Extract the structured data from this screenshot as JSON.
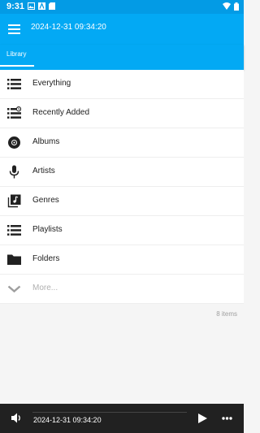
{
  "status_bar": {
    "time": "9:31",
    "left_icons": [
      "image-icon",
      "font-icon",
      "sd-card-icon"
    ],
    "right_icons": [
      "wifi-icon",
      "battery-icon"
    ]
  },
  "app_bar": {
    "title": "2024-12-31 09:34:20",
    "menu_icon": "hamburger-menu-icon"
  },
  "tabs": [
    {
      "label": "Library",
      "selected": true
    }
  ],
  "library": {
    "items": [
      {
        "label": "Everything",
        "icon": "list-icon"
      },
      {
        "label": "Recently Added",
        "icon": "recent-list-icon"
      },
      {
        "label": "Albums",
        "icon": "album-icon"
      },
      {
        "label": "Artists",
        "icon": "microphone-icon"
      },
      {
        "label": "Genres",
        "icon": "genre-icon"
      },
      {
        "label": "Playlists",
        "icon": "playlist-icon"
      },
      {
        "label": "Folders",
        "icon": "folder-icon"
      }
    ],
    "more": {
      "label": "More...",
      "icon": "chevron-down-icon"
    },
    "count": "8 items"
  },
  "player": {
    "title": "2024-12-31 09:34:20",
    "progress": 0,
    "volume_icon": "volume-icon",
    "play_icon": "play-icon",
    "more_icon": "more-horizontal-icon"
  },
  "colors": {
    "status_bar": "#039be5",
    "app_bar": "#03a9f4",
    "player": "#212121",
    "icon": "#212121"
  }
}
